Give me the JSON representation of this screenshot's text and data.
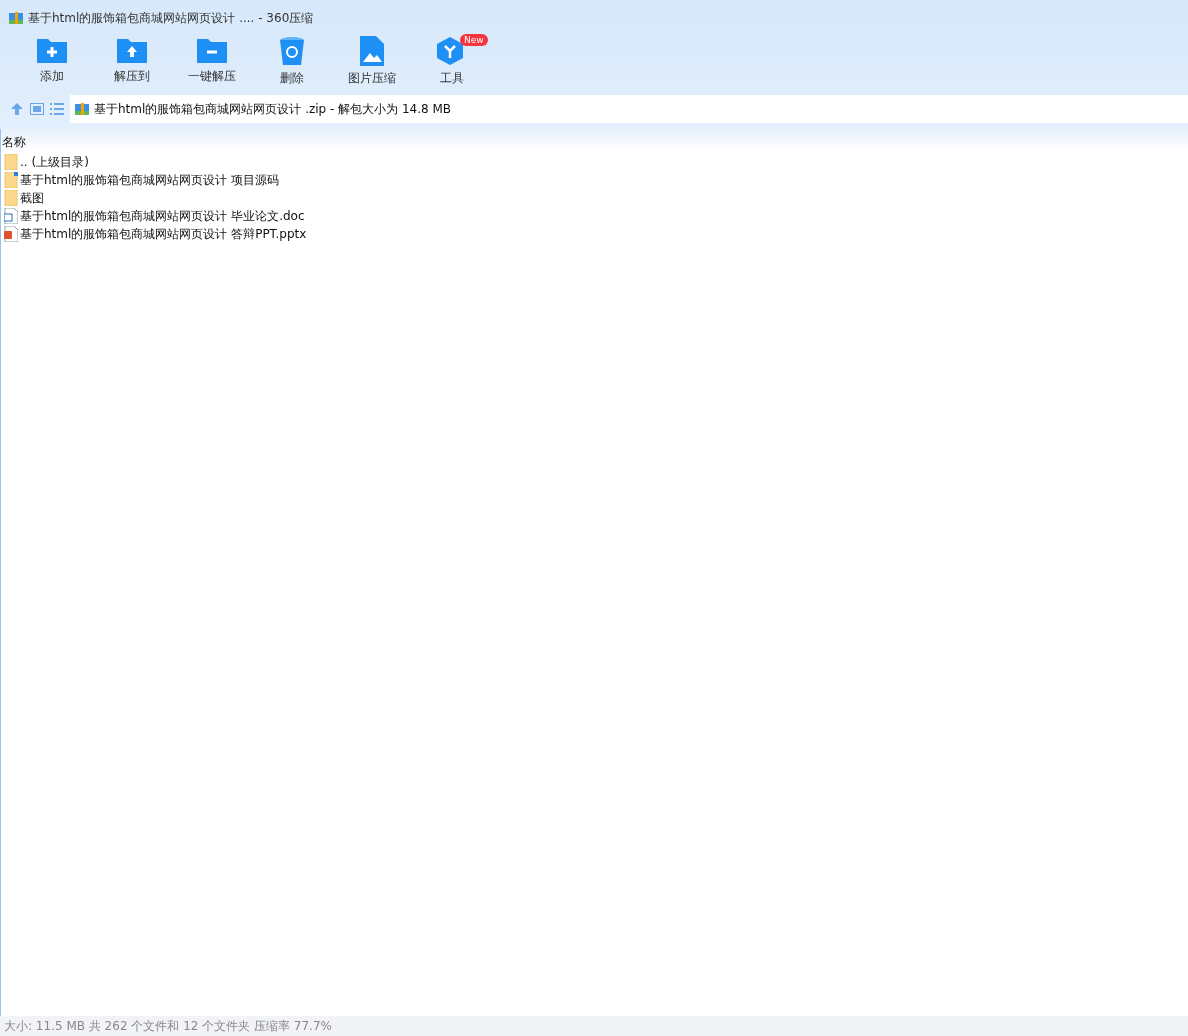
{
  "window": {
    "title": "基于html的服饰箱包商城网站网页设计 .... - 360压缩"
  },
  "toolbar": [
    {
      "kind": "add",
      "label": "添加"
    },
    {
      "kind": "extract-to",
      "label": "解压到"
    },
    {
      "kind": "extract",
      "label": "一键解压"
    },
    {
      "kind": "delete",
      "label": "删除"
    },
    {
      "kind": "image",
      "label": "图片压缩"
    },
    {
      "kind": "tools",
      "label": "工具",
      "badge": "New"
    }
  ],
  "path_bar": {
    "path": "基于html的服饰箱包商城网站网页设计 .zip - 解包大小为 14.8 MB"
  },
  "table": {
    "columns": [
      "名称"
    ],
    "rows": [
      {
        "kind": "folder",
        "name": ".. (上级目录)"
      },
      {
        "kind": "folder-file",
        "name": "基于html的服饰箱包商城网站网页设计 项目源码"
      },
      {
        "kind": "folder",
        "name": "截图"
      },
      {
        "kind": "doc",
        "name": "基于html的服饰箱包商城网站网页设计  毕业论文.doc"
      },
      {
        "kind": "ppt",
        "name": "基于html的服饰箱包商城网站网页设计  答辩PPT.pptx"
      }
    ]
  },
  "status_bar": "大小: 11.5 MB 共 262 个文件和 12 个文件夹 压缩率 77.7%"
}
